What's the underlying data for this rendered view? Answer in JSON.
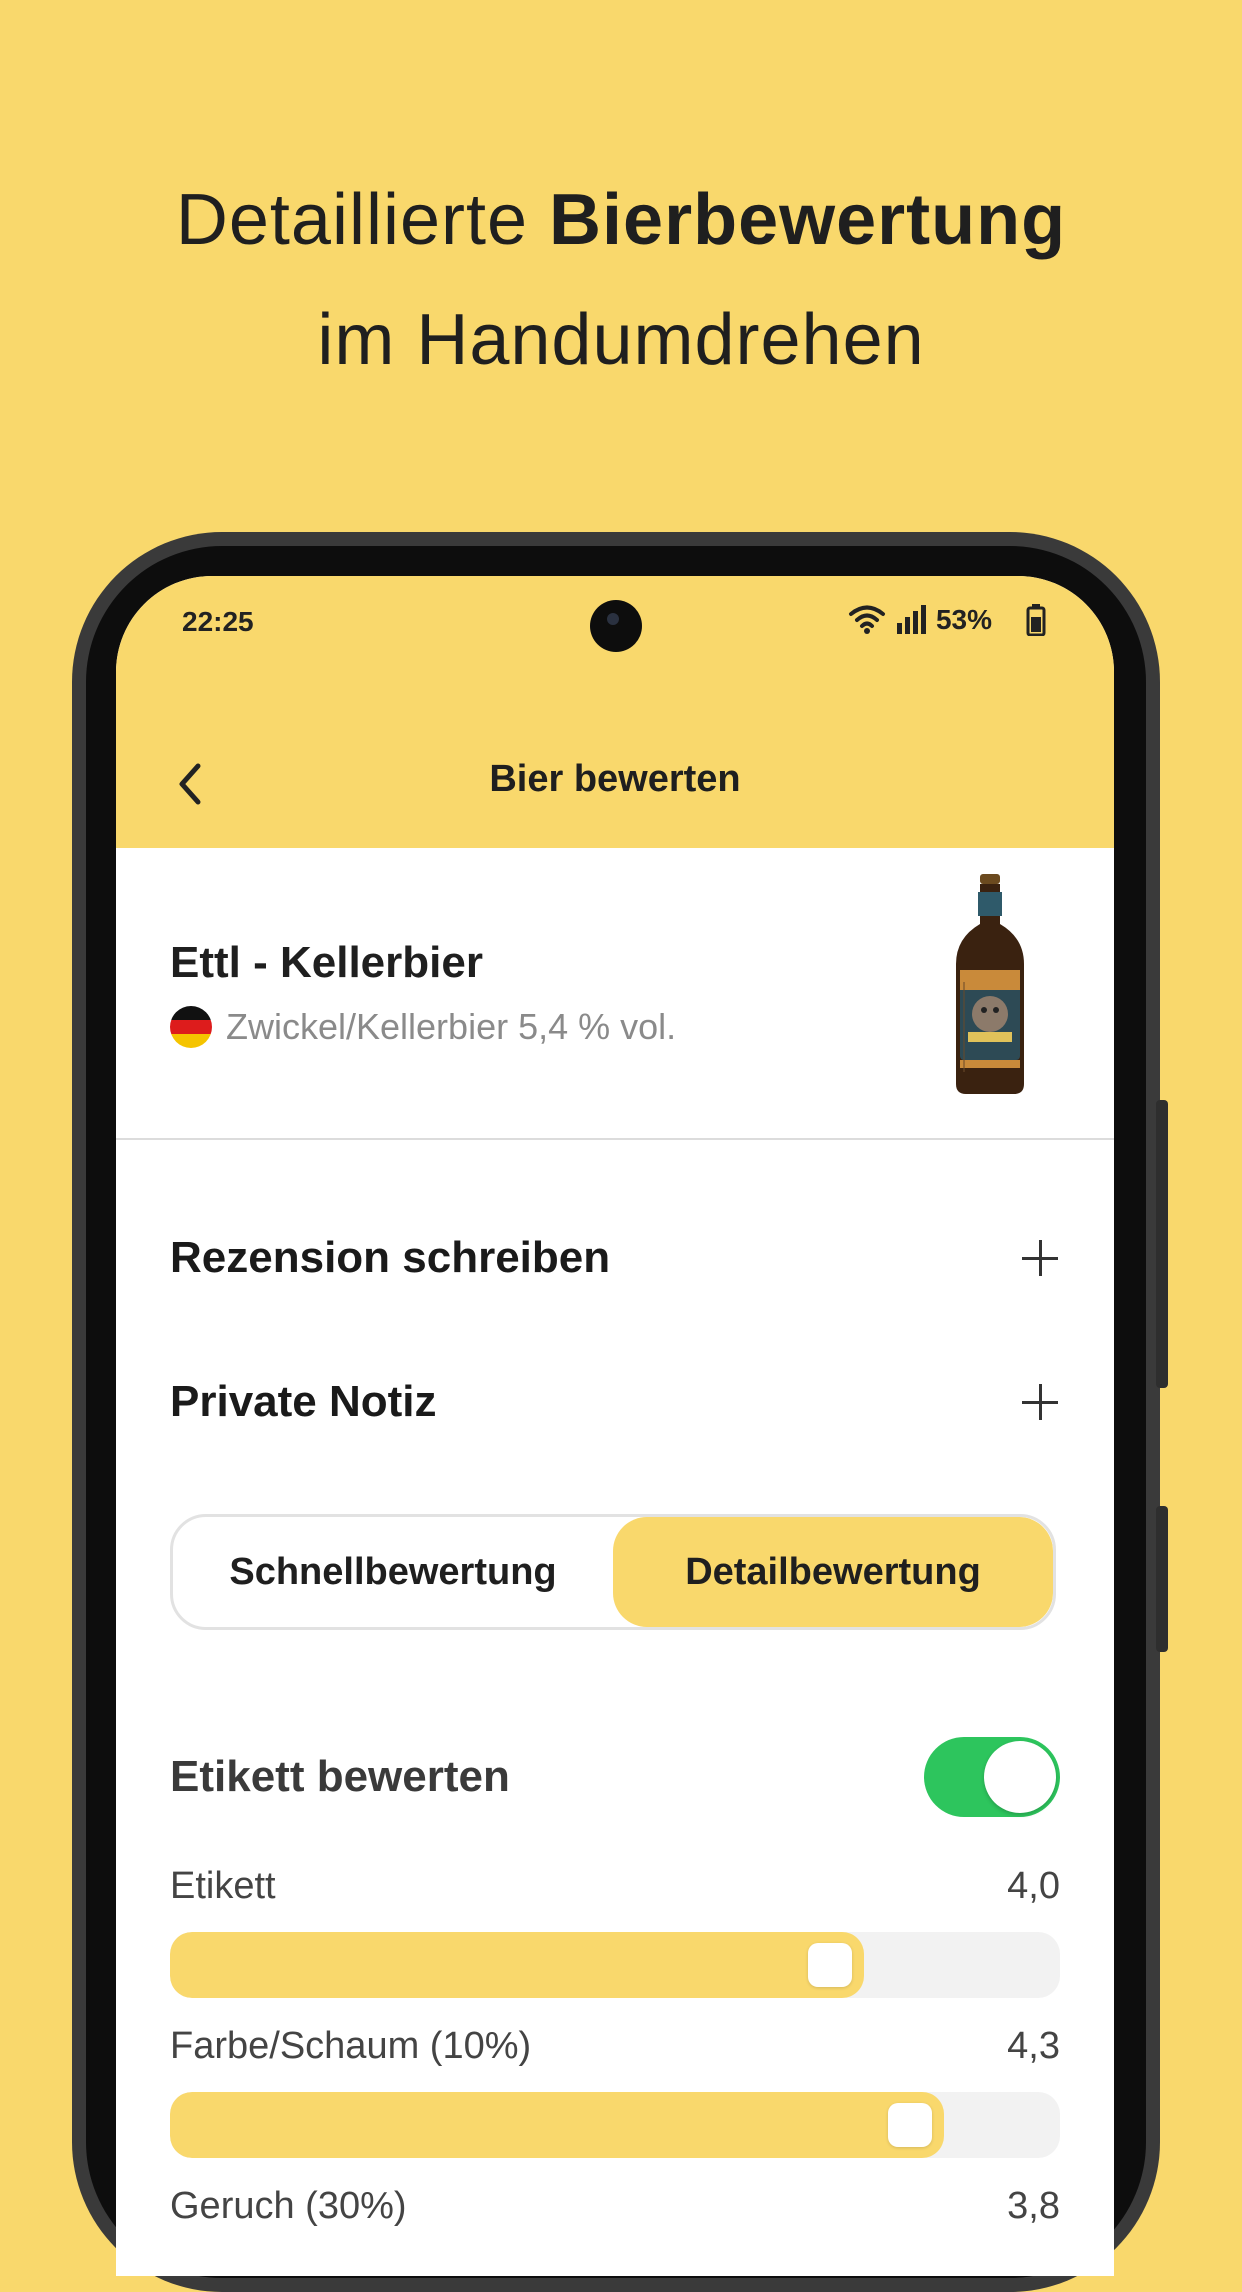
{
  "headline": {
    "line1_regular": "Detaillierte ",
    "line1_bold": "Bierbewertung",
    "line2": "im Handumdrehen"
  },
  "status_bar": {
    "time": "22:25",
    "battery_percent": "53%",
    "icons": [
      "wifi-icon",
      "signal-icon",
      "battery-icon"
    ]
  },
  "nav": {
    "title": "Bier bewerten",
    "back_icon": "chevron-left-icon"
  },
  "beer": {
    "name": "Ettl - Kellerbier",
    "country_flag": "germany-flag-icon",
    "style_and_abv": "Zwickel/Kellerbier 5,4 % vol."
  },
  "actions": {
    "write_review": "Rezension schreiben",
    "private_note": "Private Notiz"
  },
  "rating_mode": {
    "options": [
      "Schnellbewertung",
      "Detailbewertung"
    ],
    "selected": "Detailbewertung"
  },
  "label_toggle": {
    "label": "Etikett bewerten",
    "on": true
  },
  "sliders": [
    {
      "label": "Etikett",
      "value_text": "4,0",
      "fraction": 0.78
    },
    {
      "label": "Farbe/Schaum (10%)",
      "value_text": "4,3",
      "fraction": 0.87
    },
    {
      "label": "Geruch (30%)",
      "value_text": "3,8"
    }
  ],
  "colors": {
    "background": "#F9D86C",
    "accent": "#F9D86C",
    "toggle_on": "#2DC55D"
  }
}
